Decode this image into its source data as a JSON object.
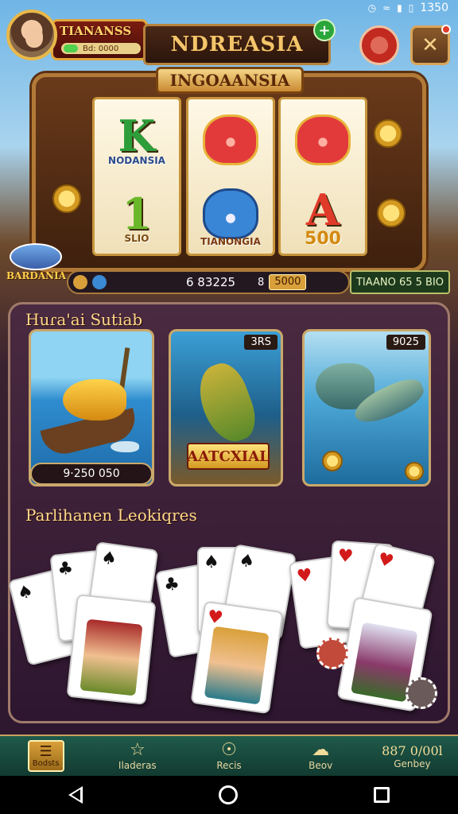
{
  "status_bar": {
    "time": "1350",
    "icons": [
      "alarm-icon",
      "wifi-icon",
      "signal-icon",
      "battery-icon"
    ]
  },
  "header": {
    "player_name": "TIANANSS",
    "player_coins": "Bd: 0000",
    "title": "NDREASIA",
    "plus_label": "+",
    "settings_label": "✕"
  },
  "slot": {
    "title": "INGOAANSIA",
    "reels": [
      {
        "top_symbol": "K",
        "top_caption": "NODANSIA",
        "bottom_symbol": "1",
        "bottom_caption": "SLIO"
      },
      {
        "top_symbol": "",
        "top_caption": "",
        "bottom_symbol": "",
        "bottom_caption": "TIANONGIA"
      },
      {
        "top_symbol": "",
        "top_caption": "",
        "bottom_symbol": "A",
        "bottom_caption": "500"
      }
    ],
    "badge_label": "BARDANIA",
    "win_value": "6 83225",
    "bet_prefix": "8",
    "bet_value": "5000",
    "total_value": "TIAANO 65 5 BIO"
  },
  "featured": {
    "section_title": "Huɾa'ai Sutiab",
    "games": [
      {
        "price": "",
        "caption": "9·250 050",
        "logo": ""
      },
      {
        "price": "3RS",
        "caption": "",
        "logo": "AATCXIAL"
      },
      {
        "price": "9025",
        "caption": "",
        "logo": ""
      }
    ]
  },
  "cards": {
    "section_title": "Parlihanen Leokiqres",
    "suits": {
      "spade": "♠",
      "club": "♣",
      "heart": "♥"
    }
  },
  "bottom_nav": [
    {
      "label": "Bodsts",
      "icon": "menu-icon"
    },
    {
      "label": "Iladeras",
      "icon": "star-icon"
    },
    {
      "label": "Recis",
      "icon": "compass-icon"
    },
    {
      "label": "Beov",
      "icon": "cloud-icon"
    },
    {
      "label": "Genbey",
      "value": "887 0/00l"
    }
  ],
  "colors": {
    "accent_gold": "#e8b84a",
    "panel": "#3a1e38",
    "nav_green": "#1f5a4a",
    "chip_red": "#c22a20"
  }
}
